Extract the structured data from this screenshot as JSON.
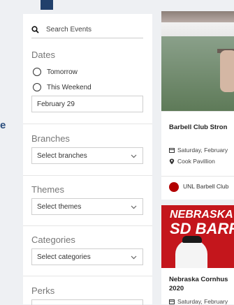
{
  "edge_letter": "e",
  "filters": {
    "search_placeholder": "Search Events",
    "dates": {
      "heading": "Dates",
      "options": [
        "Tomorrow",
        "This Weekend"
      ],
      "date_value": "February 29"
    },
    "branches": {
      "heading": "Branches",
      "select_label": "Select branches"
    },
    "themes": {
      "heading": "Themes",
      "select_label": "Select themes"
    },
    "categories": {
      "heading": "Categories",
      "select_label": "Select categories"
    },
    "perks": {
      "heading": "Perks"
    }
  },
  "events": [
    {
      "title": "Barbell Club Stron",
      "date": "Saturday, February",
      "location": "Cook Pavillion",
      "organization": "UNL Barbell Club"
    },
    {
      "banner_line1": "NEBRASKA C",
      "banner_line2": "SD BARR",
      "title": "Nebraska Cornhus 2020",
      "date": "Saturday, February"
    }
  ],
  "colors": {
    "accent": "#21406b",
    "brand_red": "#c4161c"
  }
}
